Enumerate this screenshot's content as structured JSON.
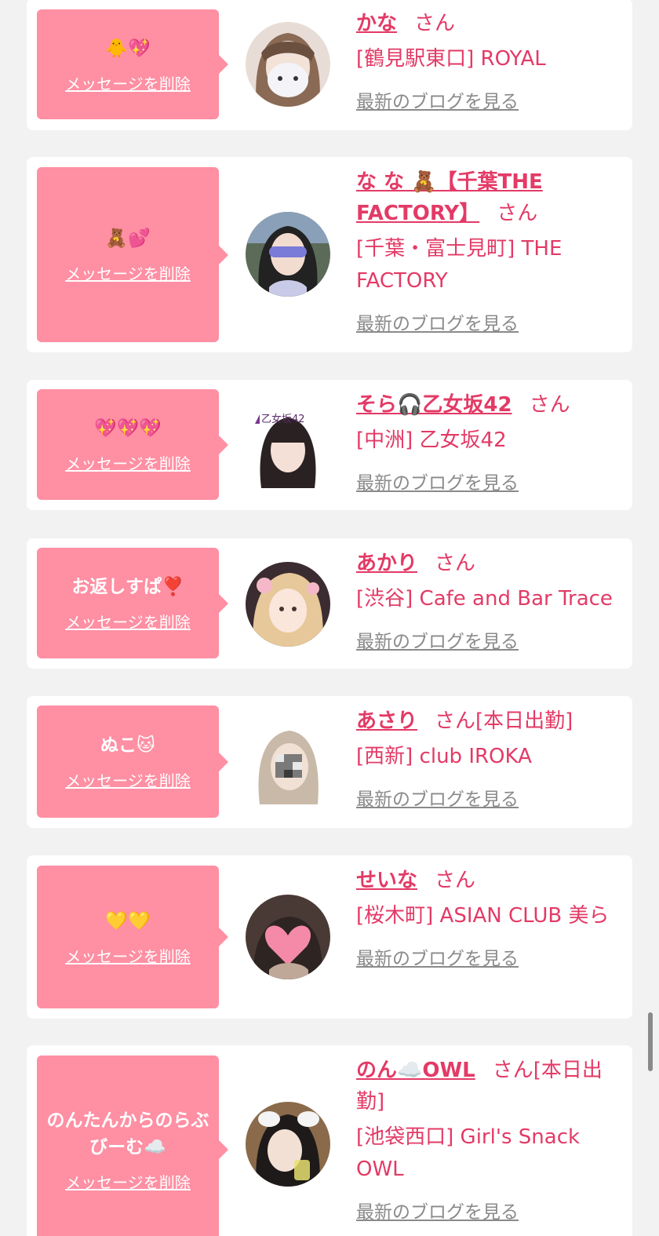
{
  "rows": [
    {
      "message": "🐥💖",
      "delete_label": "メッセージを削除",
      "name": "かな",
      "honorific": "さん",
      "status": "",
      "shop": "[鶴見駅東口] ROYAL",
      "blog_link": "最新のブログを見る"
    },
    {
      "message": "🧸💕",
      "delete_label": "メッセージを削除",
      "name": "な な 🧸【千葉THE FACTORY】",
      "honorific": "さん",
      "status": "",
      "shop": "[千葉・富士見町] THE FACTORY",
      "blog_link": "最新のブログを見る"
    },
    {
      "message": "💖💖💖",
      "delete_label": "メッセージを削除",
      "name": "そら🎧乙女坂42",
      "honorific": "さん",
      "status": "",
      "shop": "[中洲] 乙女坂42",
      "blog_link": "最新のブログを見る",
      "avatar_caption": "乙女坂42"
    },
    {
      "message": "お返しすぱ❣️",
      "delete_label": "メッセージを削除",
      "name": "あかり",
      "honorific": "さん",
      "status": "",
      "shop": "[渋谷] Cafe and Bar Trace",
      "blog_link": "最新のブログを見る"
    },
    {
      "message": "ぬこ🐱",
      "delete_label": "メッセージを削除",
      "name": "あさり",
      "honorific": "さん",
      "status": "[本日出勤]",
      "shop": "[西新] club IROKA",
      "blog_link": "最新のブログを見る"
    },
    {
      "message": "💛💛",
      "delete_label": "メッセージを削除",
      "name": "せいな",
      "honorific": "さん",
      "status": "",
      "shop": "[桜木町] ASIAN CLUB 美ら",
      "blog_link": "最新のブログを見る"
    },
    {
      "message": "のんたんからのらぶびーむ☁️",
      "delete_label": "メッセージを削除",
      "name": "のん☁️OWL",
      "honorific": "さん",
      "status": "[本日出勤]",
      "shop": "[池袋西口] Girl's Snack OWL",
      "blog_link": "最新のブログを見る"
    }
  ],
  "colors": {
    "bubble": "#ff8fa3",
    "accent": "#e33a66",
    "link_gray": "#8a8a8a",
    "page_bg": "#f2f2f2"
  }
}
